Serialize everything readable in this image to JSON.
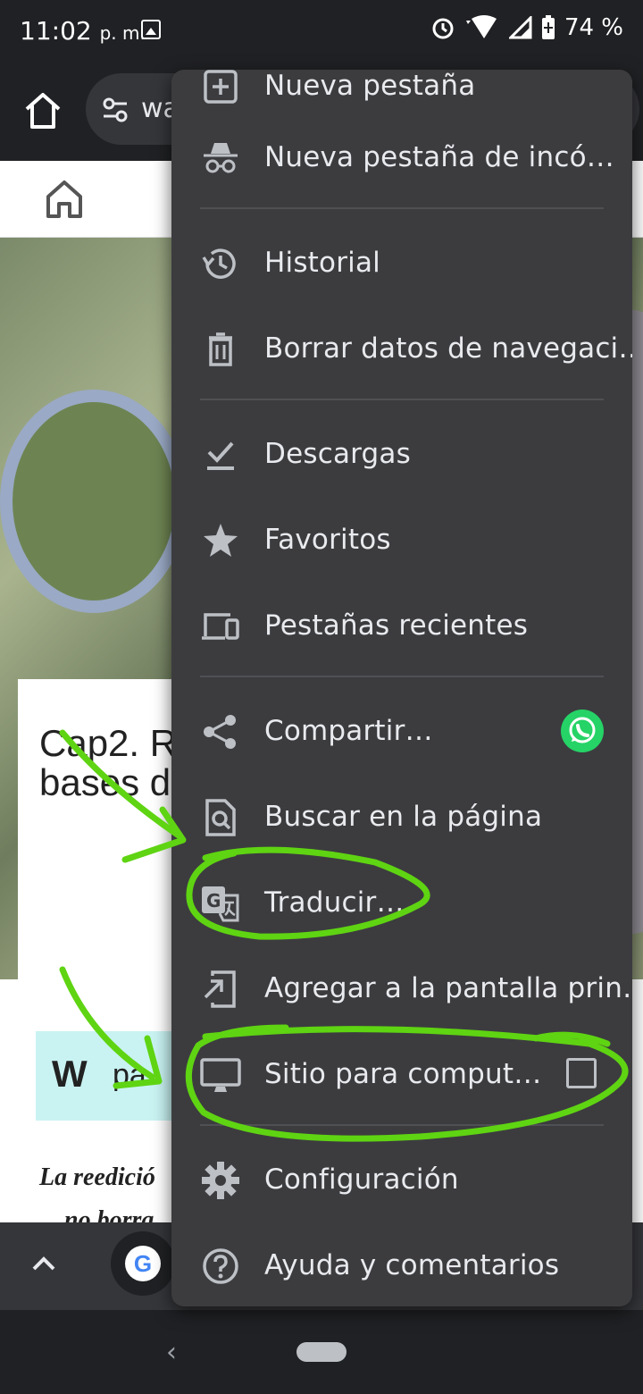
{
  "status_bar": {
    "time": "11:02",
    "ampm": "p. m.",
    "battery": "74 %"
  },
  "toolbar": {
    "url_text": "wa"
  },
  "page": {
    "title": "Cap2. R",
    "title_line2": "bases de",
    "wattpad_label": "pa",
    "paragraph": "La reedició",
    "paragraph_line2": "no borra"
  },
  "bottom_bar": {
    "google_letter": "G"
  },
  "menu": {
    "items": [
      {
        "label": "Nueva pestaña",
        "icon": "new-tab-icon"
      },
      {
        "label": "Nueva pestaña de incó…",
        "icon": "incognito-icon"
      },
      {
        "label": "Historial",
        "icon": "history-icon"
      },
      {
        "label": "Borrar datos de navegaci…",
        "icon": "trash-icon"
      },
      {
        "label": "Descargas",
        "icon": "download-icon"
      },
      {
        "label": "Favoritos",
        "icon": "star-icon"
      },
      {
        "label": "Pestañas recientes",
        "icon": "devices-icon"
      },
      {
        "label": "Compartir…",
        "icon": "share-icon"
      },
      {
        "label": "Buscar en la página",
        "icon": "find-in-page-icon"
      },
      {
        "label": "Traducir…",
        "icon": "translate-icon"
      },
      {
        "label": "Agregar a la pantalla prin…",
        "icon": "add-to-home-icon"
      },
      {
        "label": "Sitio para comput…",
        "icon": "desktop-icon",
        "checked": false
      },
      {
        "label": "Configuración",
        "icon": "settings-icon"
      },
      {
        "label": "Ayuda y comentarios",
        "icon": "help-icon"
      }
    ]
  },
  "colors": {
    "menu_bg": "#3c3c3f",
    "annotation": "#5fd412",
    "whatsapp": "#25d366"
  }
}
